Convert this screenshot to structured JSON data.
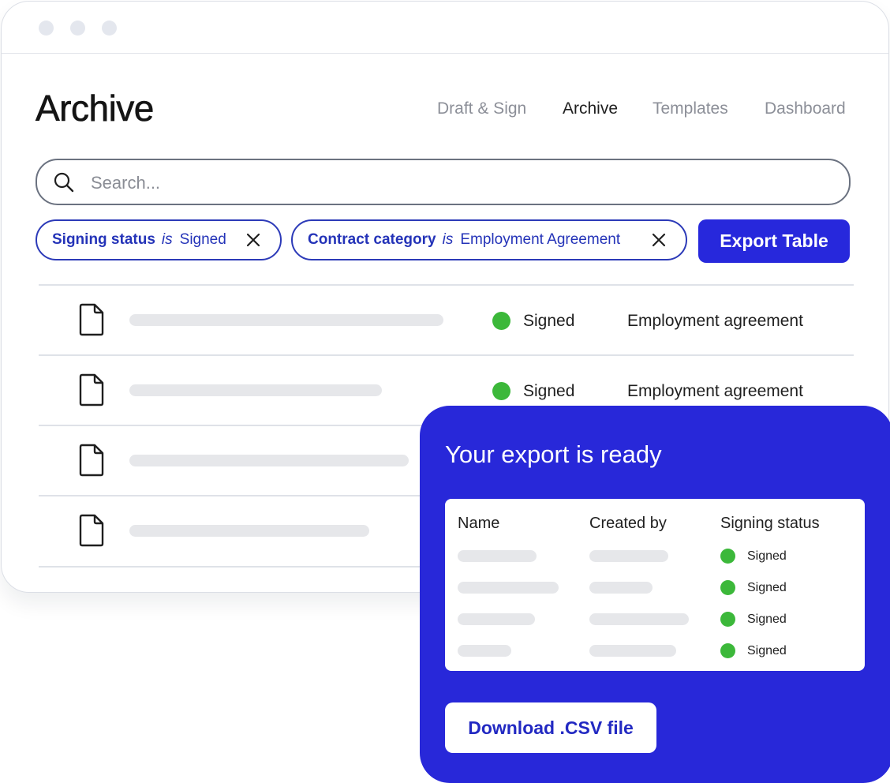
{
  "page_title": "Archive",
  "nav": [
    {
      "label": "Draft & Sign",
      "active": false
    },
    {
      "label": "Archive",
      "active": true
    },
    {
      "label": "Templates",
      "active": false
    },
    {
      "label": "Dashboard",
      "active": false
    }
  ],
  "search": {
    "placeholder": "Search...",
    "icon": "search-icon"
  },
  "filters": [
    {
      "key": "Signing status",
      "operator": "is",
      "value": "Signed"
    },
    {
      "key": "Contract category",
      "operator": "is",
      "value": "Employment Agreement"
    }
  ],
  "export_button": "Export Table",
  "rows": [
    {
      "status": "Signed",
      "category": "Employment agreement"
    },
    {
      "status": "Signed",
      "category": "Employment agreement"
    },
    {
      "status": "",
      "category": ""
    },
    {
      "status": "",
      "category": ""
    }
  ],
  "export_panel": {
    "title": "Your export is ready",
    "columns": [
      "Name",
      "Created by",
      "Signing status"
    ],
    "rows": [
      {
        "status": "Signed"
      },
      {
        "status": "Signed"
      },
      {
        "status": "Signed"
      },
      {
        "status": "Signed"
      }
    ],
    "download_label": "Download .CSV file"
  },
  "colors": {
    "accent": "#2728DC",
    "chip_text": "#2433B8",
    "status_signed": "#3CB83A",
    "placeholder_bar": "#E6E7EA"
  }
}
